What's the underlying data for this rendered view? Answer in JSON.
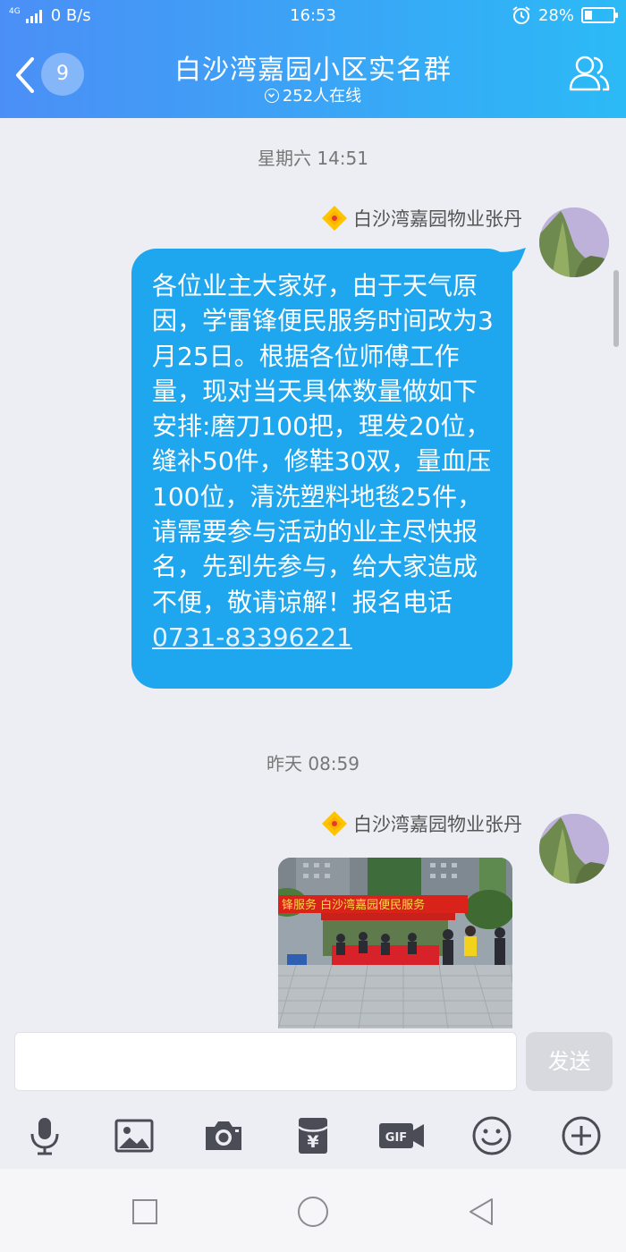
{
  "status_bar": {
    "network": "4G",
    "speed": "0 B/s",
    "time": "16:53",
    "battery": "28%",
    "battery_level": 0.28
  },
  "header": {
    "unread_count": "9",
    "title": "白沙湾嘉园小区实名群",
    "online": "252人在线"
  },
  "messages": [
    {
      "timestamp": "星期六 14:51",
      "sender": "白沙湾嘉园物业张丹",
      "text": "各位业主大家好，由于天气原因，学雷锋便民服务时间改为3月25日。根据各位师傅工作量，现对当天具体数量做如下安排:磨刀100把，理发20位，缝补50件，修鞋30双，量血压100位，清洗塑料地毯25件，请需要参与活动的业主尽快报名，先到先参与，给大家造成不便，敬请谅解！报名电话",
      "phone": "0731-83396221"
    },
    {
      "timestamp": "昨天 08:59",
      "sender": "白沙湾嘉园物业张丹",
      "photo_banner": "锋服务  白沙湾嘉园便民服务"
    }
  ],
  "input": {
    "placeholder": "",
    "send_label": "发送"
  },
  "toolbar": {
    "icons": [
      "microphone-icon",
      "image-icon",
      "camera-icon",
      "red-packet-icon",
      "gif-icon",
      "emoji-icon",
      "plus-icon"
    ],
    "gif_text": "GIF",
    "yen_text": "¥"
  },
  "nav": {
    "buttons": [
      "recents-button",
      "home-button",
      "back-button"
    ]
  },
  "colors": {
    "header_gradient_start": "#4b8ff6",
    "header_gradient_end": "#2bbaf6",
    "bubble": "#1ea6ee",
    "chat_background": "#eceef3",
    "send_disabled": "#d7d9de"
  }
}
